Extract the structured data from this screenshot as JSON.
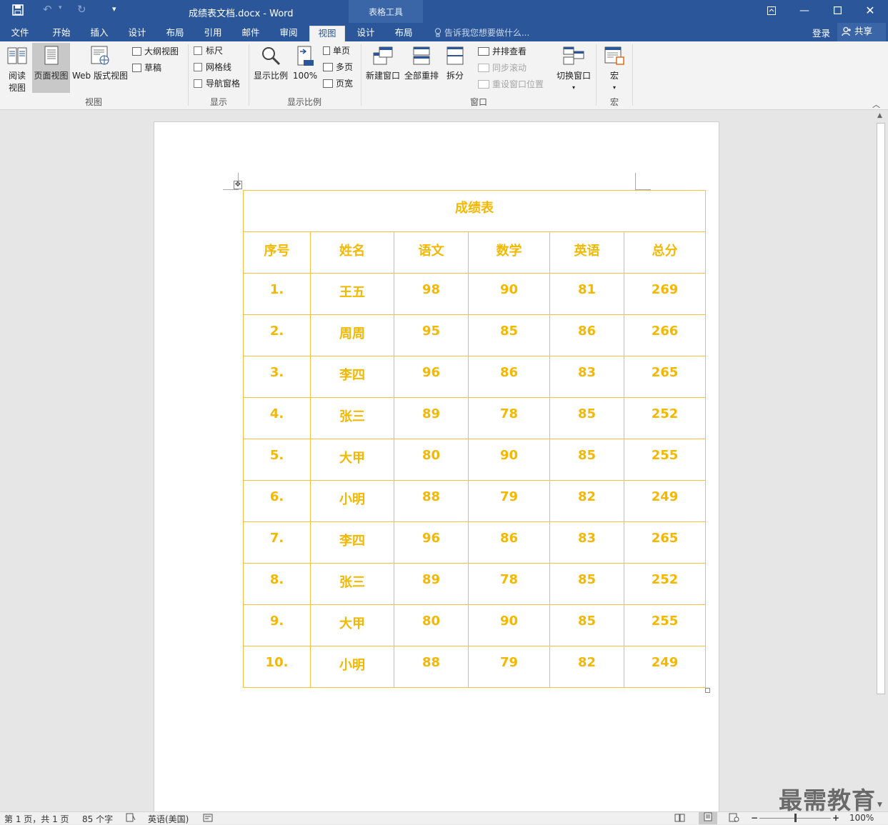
{
  "titlebar": {
    "doc_title": "成绩表文档.docx - Word",
    "context_group": "表格工具",
    "icons": [
      "save-icon",
      "undo-icon",
      "redo-icon",
      "customize-quick-access-icon"
    ],
    "window_buttons": [
      "ribbon-display-icon",
      "minimize-icon",
      "maximize-icon",
      "close-icon"
    ]
  },
  "tabs": [
    "文件",
    "开始",
    "插入",
    "设计",
    "布局",
    "引用",
    "邮件",
    "审阅",
    "视图",
    "设计",
    "布局"
  ],
  "active_tab": "视图",
  "tell_me": "告诉我您想要做什么...",
  "login": "登录",
  "share": "共享",
  "ribbon": {
    "views": {
      "label": "视图",
      "read_mode": [
        "阅读",
        "视图"
      ],
      "print_layout": "页面视图",
      "web_layout": "Web 版式视图",
      "outline": "大纲视图",
      "draft": "草稿"
    },
    "show": {
      "label": "显示",
      "ruler": "标尺",
      "gridlines": "网格线",
      "nav_pane": "导航窗格"
    },
    "zoom": {
      "label": "显示比例",
      "zoom": "显示比例",
      "hundred": "100%",
      "one_page": "单页",
      "multi_page": "多页",
      "page_width": "页宽"
    },
    "window": {
      "label": "窗口",
      "new_window": "新建窗口",
      "arrange_all": "全部重排",
      "split": "拆分",
      "side_by_side": "并排查看",
      "sync_scroll": "同步滚动",
      "reset_position": "重设窗口位置",
      "switch_windows": "切换窗口"
    },
    "macros": {
      "label": "宏",
      "macro": "宏"
    }
  },
  "table": {
    "title": "成绩表",
    "headers": [
      "序号",
      "姓名",
      "语文",
      "数学",
      "英语",
      "总分"
    ],
    "rows": [
      [
        "1.",
        "王五",
        "98",
        "90",
        "81",
        "269"
      ],
      [
        "2.",
        "周周",
        "95",
        "85",
        "86",
        "266"
      ],
      [
        "3.",
        "李四",
        "96",
        "86",
        "83",
        "265"
      ],
      [
        "4.",
        "张三",
        "89",
        "78",
        "85",
        "252"
      ],
      [
        "5.",
        "大甲",
        "80",
        "90",
        "85",
        "255"
      ],
      [
        "6.",
        "小明",
        "88",
        "79",
        "82",
        "249"
      ],
      [
        "7.",
        "李四",
        "96",
        "86",
        "83",
        "265"
      ],
      [
        "8.",
        "张三",
        "89",
        "78",
        "85",
        "252"
      ],
      [
        "9.",
        "大甲",
        "80",
        "90",
        "85",
        "255"
      ],
      [
        "10.",
        "小明",
        "88",
        "79",
        "82",
        "249"
      ]
    ],
    "text_color": "#f5b800",
    "border_color": "#f5c042"
  },
  "status": {
    "page": "第 1 页，共 1 页",
    "words": "85 个字",
    "language": "英语(美国)",
    "zoom": "100%",
    "zoom_level": 1.0
  },
  "watermark": "最需教育",
  "colors": {
    "accent": "#2b579a",
    "context": "#3a66a8"
  }
}
